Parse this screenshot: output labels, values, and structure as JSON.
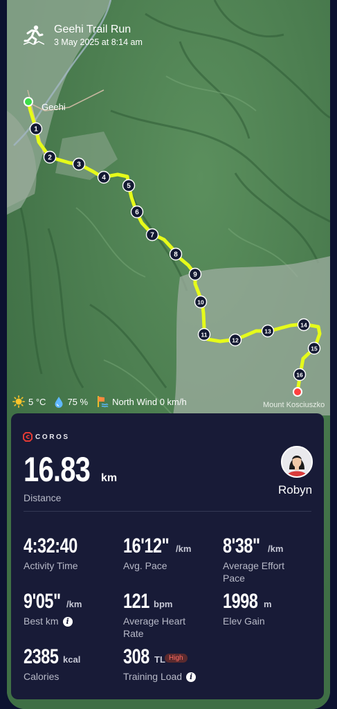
{
  "activity": {
    "title": "Geehi Trail Run",
    "datetime": "3 May 2025 at 8:14 am",
    "icon": "runner-icon"
  },
  "map": {
    "place_label": "Geehi",
    "destination_label": "Mount Kosciuszko",
    "km_markers": [
      "1",
      "2",
      "3",
      "4",
      "5",
      "6",
      "7",
      "8",
      "9",
      "10",
      "11",
      "12",
      "13",
      "14",
      "15",
      "16"
    ],
    "route_color": "#e6fb1a",
    "start_color": "#3ddc4a",
    "finish_color": "#ff4040"
  },
  "weather": {
    "temperature": "5 °C",
    "humidity": "75 %",
    "wind": "North Wind 0 km/h"
  },
  "summary": {
    "brand": "COROS",
    "distance_value": "16.83",
    "distance_unit": "km",
    "distance_label": "Distance",
    "user_name": "Robyn"
  },
  "stats": {
    "activity_time": {
      "value": "4:32:40",
      "unit": "",
      "label": "Activity Time"
    },
    "avg_pace": {
      "value": "16'12\"",
      "unit": "/km",
      "label": "Avg. Pace"
    },
    "avg_effort_pace": {
      "value": "8'38\"",
      "unit": "/km",
      "label": "Average Effort Pace"
    },
    "best_km": {
      "value": "9'05\"",
      "unit": "/km",
      "label": "Best km"
    },
    "avg_heart_rate": {
      "value": "121",
      "unit": "bpm",
      "label": "Average Heart Rate"
    },
    "elev_gain": {
      "value": "1998",
      "unit": "m",
      "label": "Elev Gain"
    },
    "calories": {
      "value": "2385",
      "unit": "kcal",
      "label": "Calories"
    },
    "training_load": {
      "value": "308",
      "unit": "TL",
      "label": "Training Load",
      "level": "High"
    }
  }
}
